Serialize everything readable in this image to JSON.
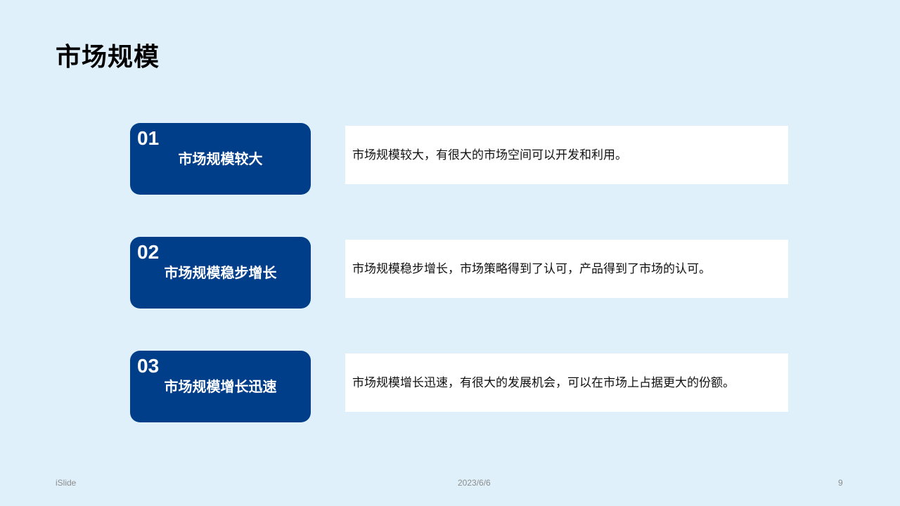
{
  "slide": {
    "title": "市场规模",
    "items": [
      {
        "number": "01",
        "heading": "市场规模较大",
        "description": "市场规模较大，有很大的市场空间可以开发和利用。"
      },
      {
        "number": "02",
        "heading": "市场规模稳步增长",
        "description": "市场规模稳步增长，市场策略得到了认可，产品得到了市场的认可。"
      },
      {
        "number": "03",
        "heading": "市场规模增长迅速",
        "description": "市场规模增长迅速，有很大的发展机会，可以在市场上占据更大的份额。"
      }
    ]
  },
  "footer": {
    "brand": "iSlide",
    "date": "2023/6/6",
    "page": "9"
  },
  "colors": {
    "background": "#dff0fb",
    "card": "#003e8a",
    "panel": "#ffffff"
  }
}
